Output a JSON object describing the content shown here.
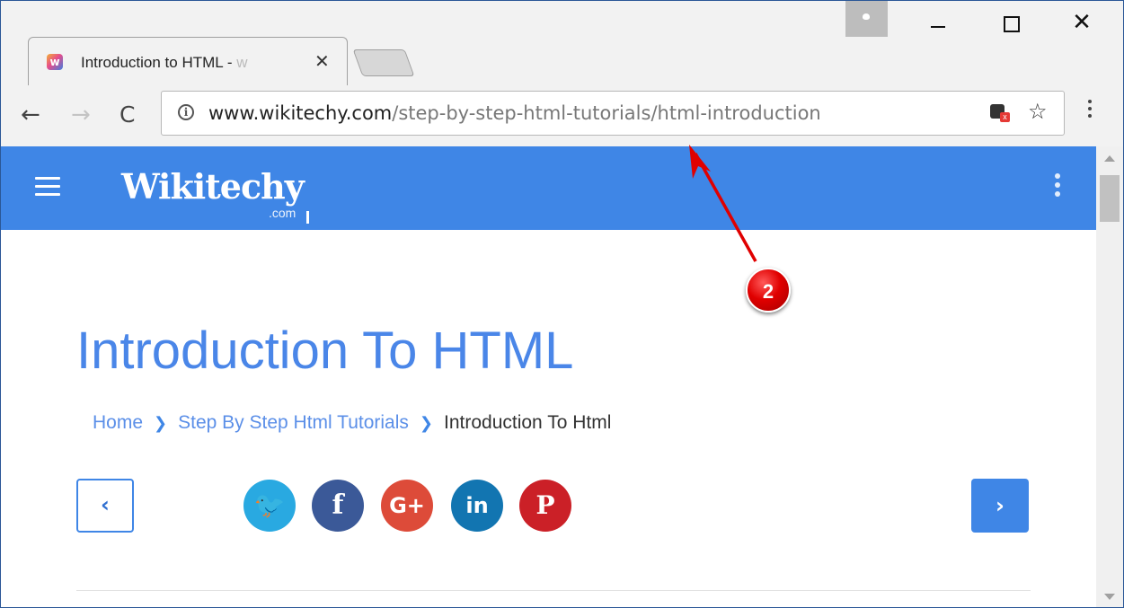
{
  "browser": {
    "tab": {
      "favicon_letter": "w",
      "title": "Introduction to HTML - ",
      "title_fade": "w",
      "close_glyph": "✕"
    },
    "window_controls": {
      "close_glyph": "✕"
    },
    "toolbar": {
      "back_glyph": "←",
      "forward_glyph": "→",
      "reload_glyph": "C",
      "info_glyph": "i",
      "url_host": "www.wikitechy.com",
      "url_path": "/step-by-step-html-tutorials/html-introduction",
      "star_glyph": "☆",
      "extension_badge": "x"
    },
    "icons": [
      "profile-icon",
      "minimize-icon",
      "maximize-icon",
      "close-icon",
      "back-arrow-icon",
      "forward-arrow-icon",
      "reload-icon",
      "info-icon",
      "extension-icon",
      "bookmark-star-icon",
      "kebab-menu-icon"
    ]
  },
  "site": {
    "logo": "Wikitechy",
    "logo_sub": ".com",
    "header_color": "#3f86e6"
  },
  "page": {
    "title": "Introduction To HTML",
    "breadcrumb": {
      "home": "Home",
      "section": "Step By Step Html Tutorials",
      "current": "Introduction To Html",
      "separator": "❯"
    },
    "prev_glyph": "‹",
    "next_glyph": "›",
    "social": {
      "twitter": "🐦",
      "facebook": "f",
      "googleplus": "G+",
      "linkedin": "in",
      "pinterest": "P"
    }
  },
  "annotation": {
    "number": "2",
    "color": "#e00000"
  }
}
